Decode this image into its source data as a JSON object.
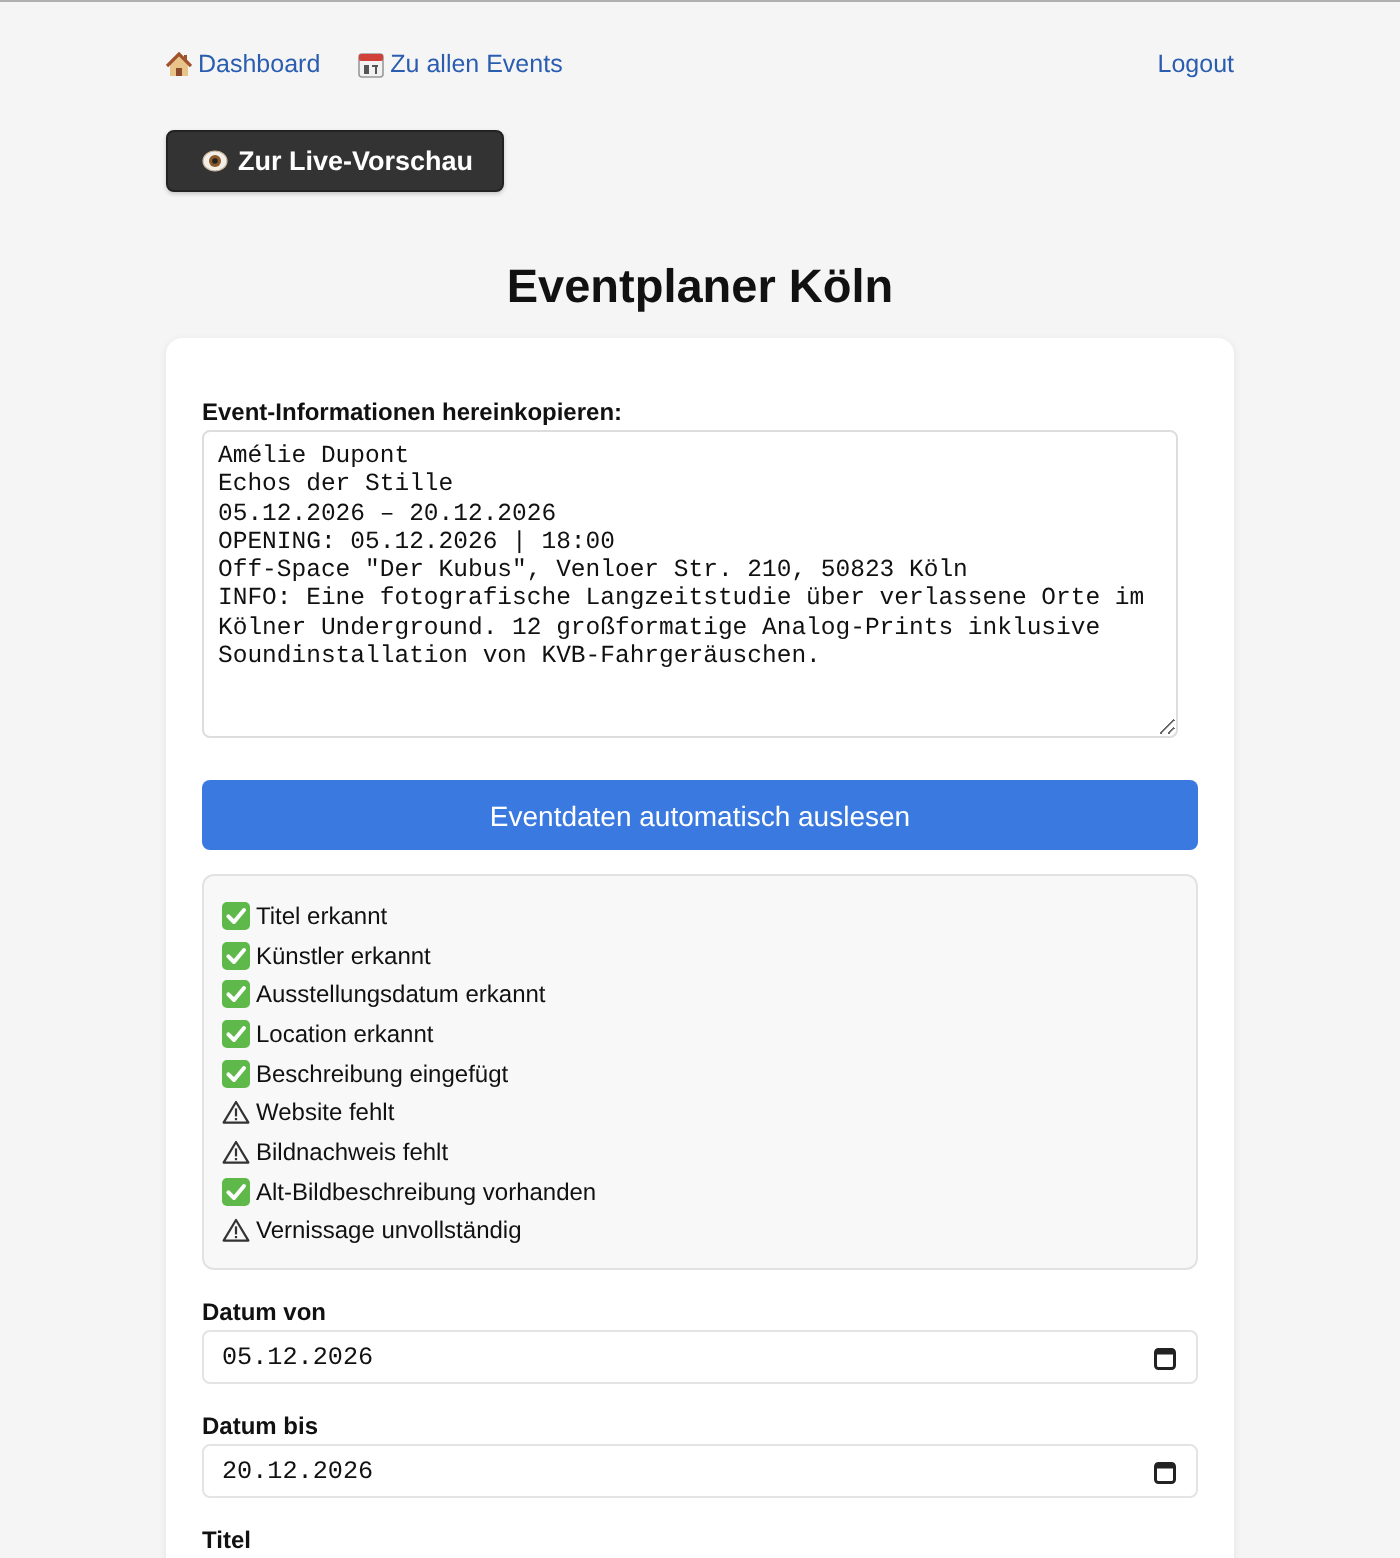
{
  "nav": {
    "links": [
      {
        "kind": "house",
        "label": "Dashboard"
      },
      {
        "kind": "calendar",
        "label": "Zu allen Events"
      }
    ],
    "logout": "Logout"
  },
  "preview_button": {
    "kind": "eye",
    "label": "Zur Live-Vorschau"
  },
  "title": "Eventplaner Köln",
  "paste": {
    "label": "Event-Informationen hereinkopieren:",
    "value": "Amélie Dupont\nEchos der Stille\n05.12.2026 – 20.12.2026\nOPENING: 05.12.2026 | 18:00\nOff-Space \"Der Kubus\", Venloer Str. 210, 50823 Köln\nINFO: Eine fotografische Langzeitstudie über verlassene Orte im\nKölner Underground. 12 großformatige Analog-Prints inklusive\nSoundinstallation von KVB-Fahrgeräuschen."
  },
  "parse_button": "Eventdaten automatisch auslesen",
  "checks": [
    {
      "kind": "ok",
      "text": "Titel erkannt"
    },
    {
      "kind": "ok",
      "text": "Künstler erkannt"
    },
    {
      "kind": "ok",
      "text": "Ausstellungsdatum erkannt"
    },
    {
      "kind": "ok",
      "text": "Location erkannt"
    },
    {
      "kind": "ok",
      "text": "Beschreibung eingefügt"
    },
    {
      "kind": "warning",
      "text": "Website fehlt"
    },
    {
      "kind": "warning",
      "text": "Bildnachweis fehlt"
    },
    {
      "kind": "ok",
      "text": "Alt-Bildbeschreibung vorhanden"
    },
    {
      "kind": "warning",
      "text": "Vernissage unvollständig"
    }
  ],
  "fields": [
    {
      "kind": "date",
      "label": "Datum von",
      "value": "05.12.2026"
    },
    {
      "kind": "date",
      "label": "Datum bis",
      "value": "20.12.2026"
    },
    {
      "label": "Titel"
    }
  ]
}
